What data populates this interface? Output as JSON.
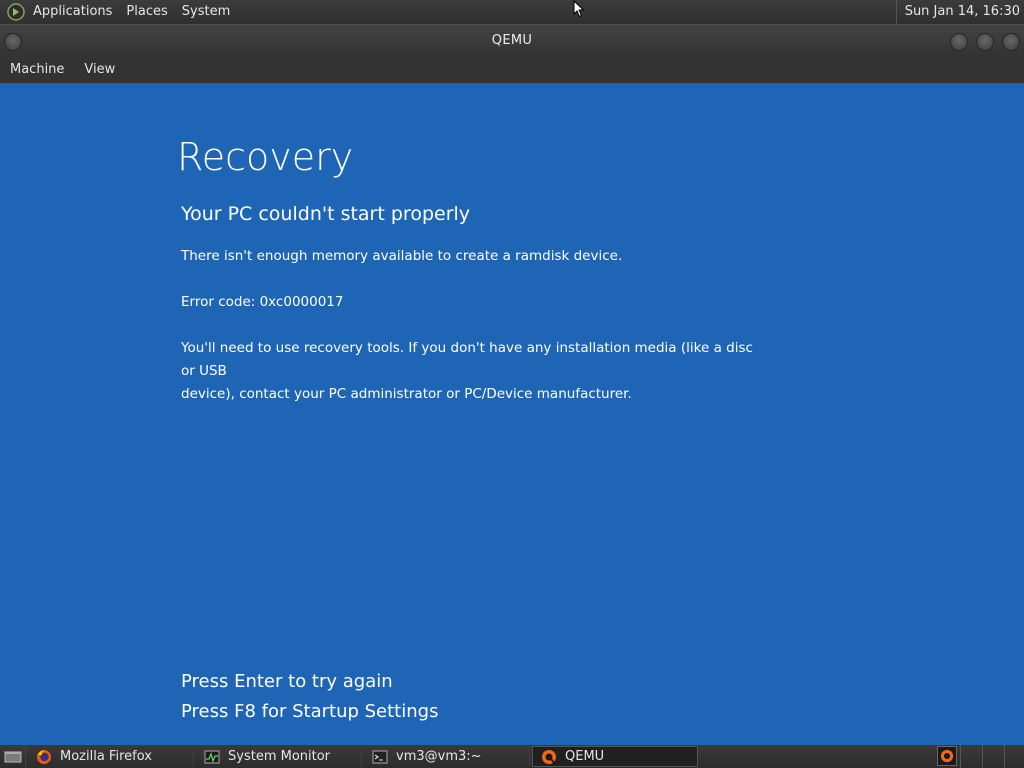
{
  "top_panel": {
    "menus": [
      "Applications",
      "Places",
      "System"
    ],
    "clock": "Sun Jan 14, 16:30"
  },
  "window": {
    "title": "QEMU",
    "menubar": [
      "Machine",
      "View"
    ]
  },
  "guest_screen": {
    "background_color": "#1e66b5",
    "title": "Recovery",
    "subtitle": "Your PC couldn't start properly",
    "message": "There isn't enough memory available to create a ramdisk device.",
    "error_code": "Error code: 0xc0000017",
    "instructions_line1": "You'll need to use recovery tools. If you don't have any installation media (like a disc or USB",
    "instructions_line2": "device), contact your PC administrator or PC/Device manufacturer.",
    "actions": [
      "Press Enter to try again",
      "Press F8 for Startup Settings"
    ]
  },
  "taskbar": {
    "tasks": [
      {
        "label": "Mozilla Firefox",
        "icon": "firefox-icon"
      },
      {
        "label": "System Monitor",
        "icon": "system-monitor-icon"
      },
      {
        "label": "vm3@vm3:~",
        "icon": "terminal-icon"
      },
      {
        "label": "QEMU",
        "icon": "qemu-icon",
        "active": true
      }
    ]
  }
}
